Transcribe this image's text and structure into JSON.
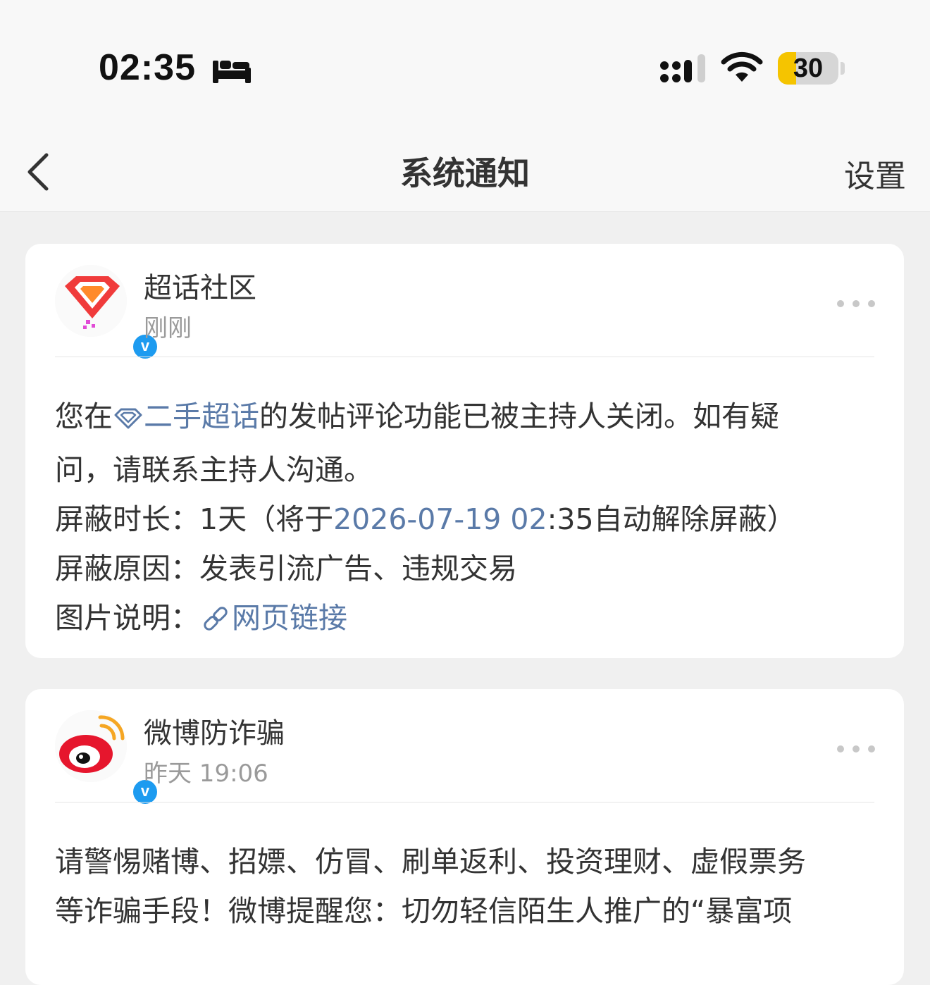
{
  "status_bar": {
    "time": "02:35",
    "battery": "30",
    "battery_level": 0.3
  },
  "nav": {
    "title": "系统通知",
    "settings": "设置"
  },
  "notifications": [
    {
      "sender": "超话社区",
      "time": "刚刚",
      "body": {
        "p1_prefix": "您在",
        "p1_link": "二手超话",
        "p1_rest": "的发帖评论功能已被主持人关闭。如有疑",
        "p1_line2": "问，请联系主持人沟通。",
        "duration_label": "屏蔽时长：",
        "duration_value": "1天（将于",
        "duration_date": "2026-07-19 02",
        "duration_colon": ":",
        "duration_minutes": "35",
        "duration_suffix": "自动解除屏蔽）",
        "reason_label": "屏蔽原因：",
        "reason_value": "发表引流广告、违规交易",
        "image_label": "图片说明：",
        "image_link": "网页链接"
      }
    },
    {
      "sender": "微博防诈骗",
      "time": "昨天 19:06",
      "body": {
        "line1": "请警惕赌博、招嫖、仿冒、刷单返利、投资理财、虚假票务",
        "line2": "等诈骗手段！微博提醒您：切勿轻信陌生人推广的“暴富项"
      }
    }
  ],
  "colors": {
    "link": "#5a7aa8",
    "verified": "#1d9bf0",
    "battery_fill": "#f5c400"
  }
}
